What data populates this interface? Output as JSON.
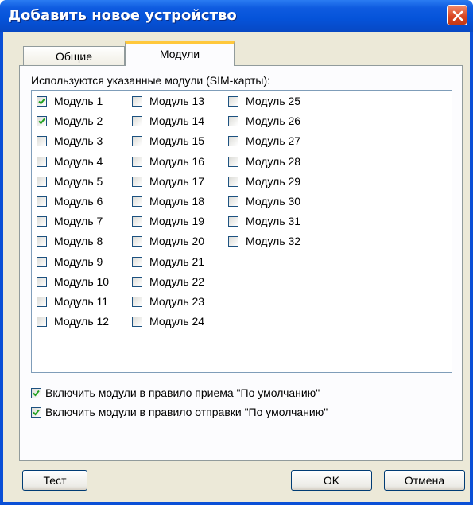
{
  "window": {
    "title": "Добавить новое устройство"
  },
  "tabs": [
    {
      "label": "Общие",
      "active": false
    },
    {
      "label": "Модули",
      "active": true
    }
  ],
  "modules_group_label": "Используются указанные модули (SIM-карты):",
  "modules": [
    {
      "label": "Модуль 1",
      "checked": true
    },
    {
      "label": "Модуль 2",
      "checked": true
    },
    {
      "label": "Модуль 3",
      "checked": false
    },
    {
      "label": "Модуль 4",
      "checked": false
    },
    {
      "label": "Модуль 5",
      "checked": false
    },
    {
      "label": "Модуль 6",
      "checked": false
    },
    {
      "label": "Модуль 7",
      "checked": false
    },
    {
      "label": "Модуль 8",
      "checked": false
    },
    {
      "label": "Модуль 9",
      "checked": false
    },
    {
      "label": "Модуль 10",
      "checked": false
    },
    {
      "label": "Модуль 11",
      "checked": false
    },
    {
      "label": "Модуль 12",
      "checked": false
    },
    {
      "label": "Модуль 13",
      "checked": false
    },
    {
      "label": "Модуль 14",
      "checked": false
    },
    {
      "label": "Модуль 15",
      "checked": false
    },
    {
      "label": "Модуль 16",
      "checked": false
    },
    {
      "label": "Модуль 17",
      "checked": false
    },
    {
      "label": "Модуль 18",
      "checked": false
    },
    {
      "label": "Модуль 19",
      "checked": false
    },
    {
      "label": "Модуль 20",
      "checked": false
    },
    {
      "label": "Модуль 21",
      "checked": false
    },
    {
      "label": "Модуль 22",
      "checked": false
    },
    {
      "label": "Модуль 23",
      "checked": false
    },
    {
      "label": "Модуль 24",
      "checked": false
    },
    {
      "label": "Модуль 25",
      "checked": false
    },
    {
      "label": "Модуль 26",
      "checked": false
    },
    {
      "label": "Модуль 27",
      "checked": false
    },
    {
      "label": "Модуль 28",
      "checked": false
    },
    {
      "label": "Модуль 29",
      "checked": false
    },
    {
      "label": "Модуль 30",
      "checked": false
    },
    {
      "label": "Модуль 31",
      "checked": false
    },
    {
      "label": "Модуль 32",
      "checked": false
    }
  ],
  "options": [
    {
      "label": "Включить модули в правило приема \"По умолчанию\"",
      "checked": true
    },
    {
      "label": "Включить модули в правило отправки \"По умолчанию\"",
      "checked": true
    }
  ],
  "buttons": {
    "test": "Тест",
    "ok": "OK",
    "cancel": "Отмена"
  },
  "colors": {
    "titlebar": "#0553d9",
    "close": "#d8431f",
    "active_tab_highlight": "#ffc83c",
    "check": "#21a121",
    "face": "#ece9d8"
  },
  "icons": {
    "close": "close-icon",
    "check": "checkmark-icon"
  }
}
